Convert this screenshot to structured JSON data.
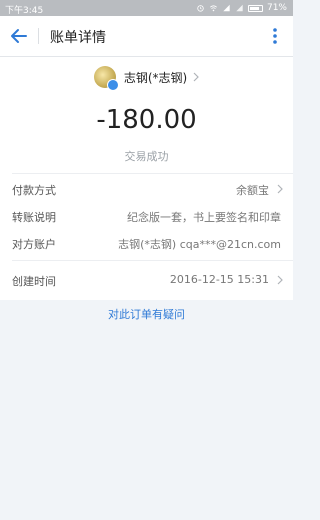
{
  "statusbar": {
    "time": "下午3:45",
    "battery": "71%"
  },
  "header": {
    "title": "账单详情"
  },
  "merchant": {
    "name": "志钢(*志钢)"
  },
  "transaction": {
    "amount": "-180.00",
    "status": "交易成功"
  },
  "details": [
    {
      "label": "付款方式",
      "value": "余额宝"
    },
    {
      "label": "转账说明",
      "value": "纪念版一套，书上要签名和印章"
    },
    {
      "label": "对方账户",
      "value": "志钢(*志钢) cqa***@21cn.com"
    },
    {
      "label": "创建时间",
      "value": "2016-12-15 15:31"
    }
  ],
  "links": {
    "doubt": "对此订单有疑问"
  },
  "colors": {
    "accent": "#2f7ad6",
    "status_bar": "#b9bcc0"
  }
}
